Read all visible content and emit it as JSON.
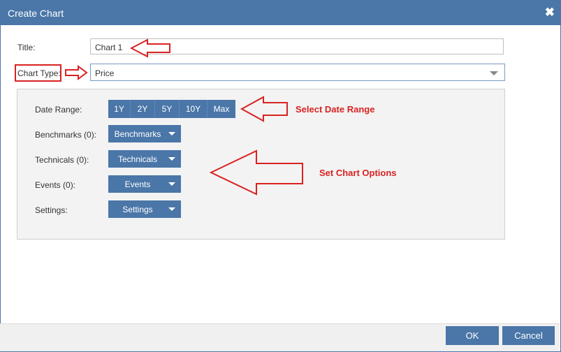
{
  "dialog": {
    "title": "Create Chart",
    "close_label": "✖"
  },
  "form": {
    "title_label": "Title:",
    "title_value": "Chart 1",
    "chart_type_label": "Chart Type:",
    "chart_type_value": "Price"
  },
  "options": {
    "date_range_label": "Date Range:",
    "date_ranges": [
      "1Y",
      "2Y",
      "5Y",
      "10Y",
      "Max"
    ],
    "benchmarks_label": "Benchmarks (0):",
    "benchmarks_button": "Benchmarks",
    "technicals_label": "Technicals (0):",
    "technicals_button": "Technicals",
    "events_label": "Events (0):",
    "events_button": "Events",
    "settings_label": "Settings:",
    "settings_button": "Settings"
  },
  "annotations": {
    "date_range_note": "Select Date Range",
    "chart_options_note": "Set Chart Options"
  },
  "footer": {
    "ok_label": "OK",
    "cancel_label": "Cancel"
  },
  "colors": {
    "accent": "#4a76a8",
    "annotation": "#d92222"
  }
}
